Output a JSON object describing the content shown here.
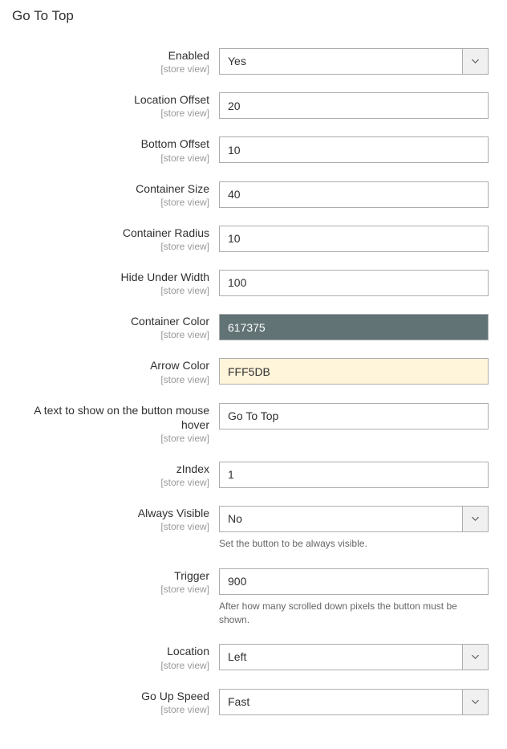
{
  "section": {
    "title": "Go To Top"
  },
  "scope": "[store view]",
  "fields": {
    "enabled": {
      "label": "Enabled",
      "value": "Yes"
    },
    "location_offset": {
      "label": "Location Offset",
      "value": "20"
    },
    "bottom_offset": {
      "label": "Bottom Offset",
      "value": "10"
    },
    "container_size": {
      "label": "Container Size",
      "value": "40"
    },
    "container_radius": {
      "label": "Container Radius",
      "value": "10"
    },
    "hide_under_width": {
      "label": "Hide Under Width",
      "value": "100"
    },
    "container_color": {
      "label": "Container Color",
      "value": "617375"
    },
    "arrow_color": {
      "label": "Arrow Color",
      "value": "FFF5DB"
    },
    "hover_text": {
      "label": "A text to show on the button mouse hover",
      "value": "Go To Top"
    },
    "zindex": {
      "label": "zIndex",
      "value": "1"
    },
    "always_visible": {
      "label": "Always Visible",
      "value": "No",
      "help": "Set the button to be always visible."
    },
    "trigger": {
      "label": "Trigger",
      "value": "900",
      "help": "After how many scrolled down pixels the button must be shown."
    },
    "location": {
      "label": "Location",
      "value": "Left"
    },
    "go_up_speed": {
      "label": "Go Up Speed",
      "value": "Fast"
    }
  }
}
